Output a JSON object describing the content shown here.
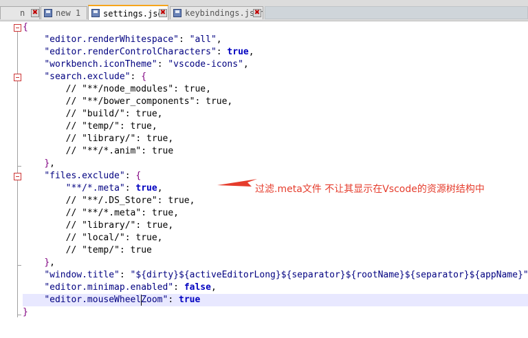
{
  "tabs": [
    {
      "label": "n",
      "active": false
    },
    {
      "label": "new 1",
      "active": false
    },
    {
      "label": "settings.json",
      "active": true
    },
    {
      "label": "keybindings.json",
      "active": false
    }
  ],
  "close_glyph": "✖",
  "editor": {
    "lines": [
      "{",
      "    \"editor.renderWhitespace\": \"all\",",
      "    \"editor.renderControlCharacters\": true,",
      "    \"workbench.iconTheme\": \"vscode-icons\",",
      "    \"search.exclude\": {",
      "        // \"**/node_modules\": true,",
      "        // \"**/bower_components\": true,",
      "        // \"build/\": true,",
      "        // \"temp/\": true,",
      "        // \"library/\": true,",
      "        // \"**/*.anim\": true",
      "    },",
      "    \"files.exclude\": {",
      "        \"**/*.meta\": true,",
      "        // \"**/.DS_Store\": true,",
      "        // \"**/*.meta\": true,",
      "        // \"library/\": true,",
      "        // \"local/\": true,",
      "        // \"temp/\": true",
      "    },",
      "    \"window.title\": \"${dirty}${activeEditorLong}${separator}${rootName}${separator}${appName}\",",
      "    \"editor.minimap.enabled\": false,",
      "    \"editor.mouseWheelZoom\": true",
      "}"
    ],
    "current_line": 22
  },
  "annotation": {
    "text": "过滤.meta文件   不让其显示在Vscode的资源树结构中",
    "color": "#e53c2c"
  }
}
